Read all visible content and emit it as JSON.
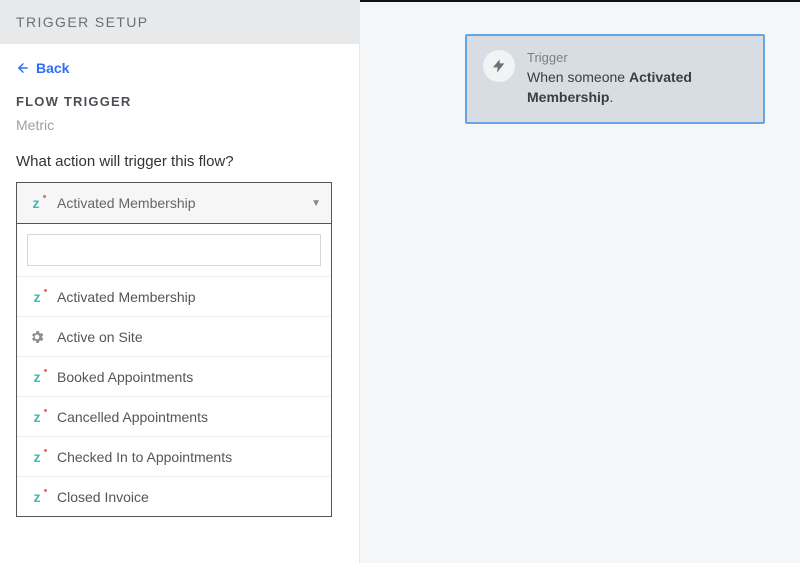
{
  "header": {
    "title": "TRIGGER SETUP"
  },
  "back": {
    "label": "Back"
  },
  "flow": {
    "title": "FLOW TRIGGER",
    "subtitle": "Metric",
    "prompt": "What action will trigger this flow?"
  },
  "dropdown": {
    "selected": "Activated Membership",
    "search_value": "",
    "options": [
      {
        "label": "Activated Membership",
        "icon": "z"
      },
      {
        "label": "Active on Site",
        "icon": "gear"
      },
      {
        "label": "Booked Appointments",
        "icon": "z"
      },
      {
        "label": "Cancelled Appointments",
        "icon": "z"
      },
      {
        "label": "Checked In to Appointments",
        "icon": "z"
      },
      {
        "label": "Closed Invoice",
        "icon": "z"
      }
    ]
  },
  "trigger_card": {
    "label": "Trigger",
    "prefix": "When someone ",
    "bold": "Activated Membership",
    "suffix": "."
  }
}
